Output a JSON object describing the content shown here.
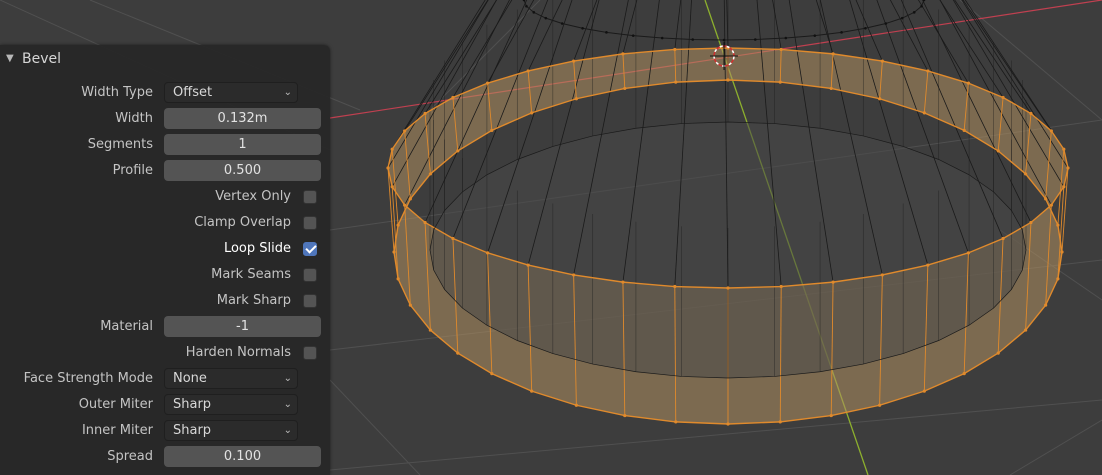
{
  "operator_panel": {
    "title": "Bevel",
    "width_type": {
      "label": "Width Type",
      "value": "Offset"
    },
    "width": {
      "label": "Width",
      "value": "0.132m"
    },
    "segments": {
      "label": "Segments",
      "value": "1"
    },
    "profile": {
      "label": "Profile",
      "value": "0.500"
    },
    "vertex_only": {
      "label": "Vertex Only",
      "checked": false
    },
    "clamp_overlap": {
      "label": "Clamp Overlap",
      "checked": false
    },
    "loop_slide": {
      "label": "Loop Slide",
      "checked": true
    },
    "mark_seams": {
      "label": "Mark Seams",
      "checked": false
    },
    "mark_sharp": {
      "label": "Mark Sharp",
      "checked": false
    },
    "material": {
      "label": "Material",
      "value": "-1"
    },
    "harden_normals": {
      "label": "Harden Normals",
      "checked": false
    },
    "face_strength_mode": {
      "label": "Face Strength Mode",
      "value": "None"
    },
    "outer_miter": {
      "label": "Outer Miter",
      "value": "Sharp"
    },
    "inner_miter": {
      "label": "Inner Miter",
      "value": "Sharp"
    },
    "spread": {
      "label": "Spread",
      "value": "0.100"
    }
  },
  "colors": {
    "viewport_bg": "#3d3d3d",
    "grid": "#505050",
    "x_axis": "#c04050",
    "y_axis": "#8db02e",
    "wire": "#1a1a1a",
    "selected_edge": "#e08a2c",
    "selected_face": "#b09060",
    "checkbox_on": "#4f76bb"
  }
}
